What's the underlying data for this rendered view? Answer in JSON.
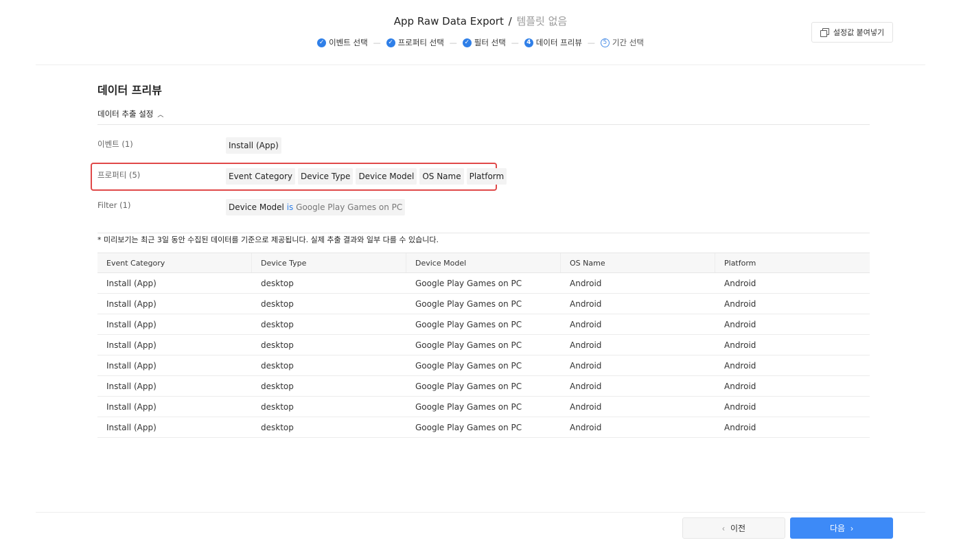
{
  "header": {
    "title": "App Raw Data Export",
    "separator": "/",
    "template": "템플릿 없음",
    "paste_label": "설정값 붙여넣기"
  },
  "steps": [
    {
      "number": "✓",
      "label": "이벤트 선택",
      "state": "done"
    },
    {
      "number": "✓",
      "label": "프로퍼티 선택",
      "state": "done"
    },
    {
      "number": "✓",
      "label": "필터 선택",
      "state": "done"
    },
    {
      "number": "4",
      "label": "데이터 프리뷰",
      "state": "current"
    },
    {
      "number": "5",
      "label": "기간 선택",
      "state": "future"
    }
  ],
  "main": {
    "section_title": "데이터 프리뷰",
    "settings_toggle": "데이터 추출 설정",
    "event_label": "이벤트 (1)",
    "events": [
      "Install (App)"
    ],
    "property_label": "프로퍼티 (5)",
    "properties": [
      "Event Category",
      "Device Type",
      "Device Model",
      "OS Name",
      "Platform"
    ],
    "filter_label": "Filter (1)",
    "filter": {
      "field": "Device Model",
      "operator": "is",
      "value": "Google Play Games on PC"
    },
    "note": "* 미리보기는 최근 3일 동안 수집된 데이터를 기준으로 제공됩니다. 실제 추출 결과와 일부 다를 수 있습니다."
  },
  "table": {
    "headers": [
      "Event Category",
      "Device Type",
      "Device Model",
      "OS Name",
      "Platform"
    ],
    "rows": [
      [
        "Install (App)",
        "desktop",
        "Google Play Games on PC",
        "Android",
        "Android"
      ],
      [
        "Install (App)",
        "desktop",
        "Google Play Games on PC",
        "Android",
        "Android"
      ],
      [
        "Install (App)",
        "desktop",
        "Google Play Games on PC",
        "Android",
        "Android"
      ],
      [
        "Install (App)",
        "desktop",
        "Google Play Games on PC",
        "Android",
        "Android"
      ],
      [
        "Install (App)",
        "desktop",
        "Google Play Games on PC",
        "Android",
        "Android"
      ],
      [
        "Install (App)",
        "desktop",
        "Google Play Games on PC",
        "Android",
        "Android"
      ],
      [
        "Install (App)",
        "desktop",
        "Google Play Games on PC",
        "Android",
        "Android"
      ],
      [
        "Install (App)",
        "desktop",
        "Google Play Games on PC",
        "Android",
        "Android"
      ]
    ]
  },
  "footer": {
    "prev_label": "이전",
    "next_label": "다음"
  },
  "colors": {
    "accent": "#3d8af7",
    "highlight_border": "#e04848"
  }
}
